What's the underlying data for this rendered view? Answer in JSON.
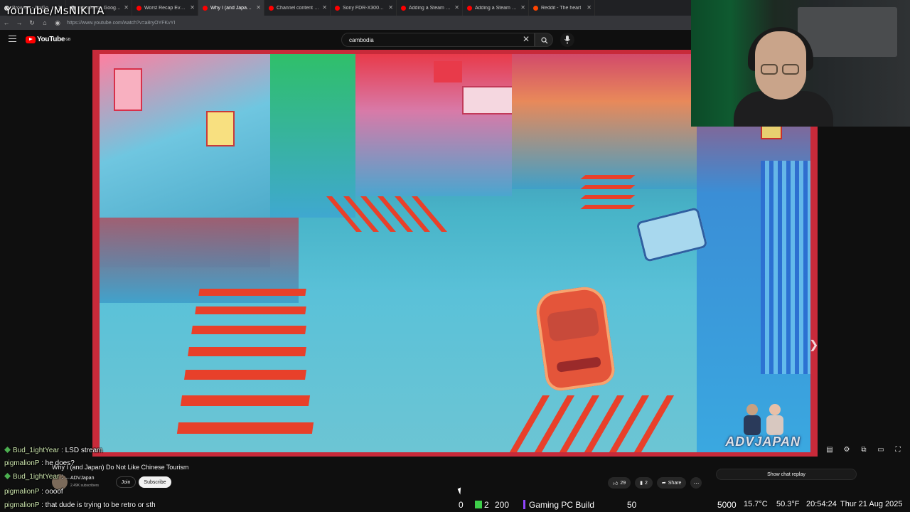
{
  "overlay": {
    "channel_handle": "YouTube/MsNIKITA"
  },
  "browser": {
    "tabs": [
      {
        "title": "Browser - AniGo",
        "favicon_color": "#ffffff",
        "active": false
      },
      {
        "title": "ridiculous - Google S",
        "favicon_color": "#e8eaed",
        "active": false
      },
      {
        "title": "Worst Recap Ever? -",
        "favicon_color": "#ff0000",
        "active": false
      },
      {
        "title": "Why I (and Japan) D",
        "favicon_color": "#ff0000",
        "active": true
      },
      {
        "title": "Channel content - Yo",
        "favicon_color": "#ff0000",
        "active": false
      },
      {
        "title": "Sony FDR-X3000 & A",
        "favicon_color": "#ff0000",
        "active": false
      },
      {
        "title": "Adding a Steam Libr",
        "favicon_color": "#ff0000",
        "active": false
      },
      {
        "title": "Adding a Steam Libr",
        "favicon_color": "#ff0000",
        "active": false
      },
      {
        "title": "Reddit - The heart",
        "favicon_color": "#ff4500",
        "active": false
      }
    ],
    "url": "https://www.youtube.com/watch?v=a8ryOYFKvYI"
  },
  "youtube": {
    "logo_text": "YouTube",
    "logo_superscript": "GB",
    "search_query": "cambodia",
    "video": {
      "title": "Why I (and Japan) Do Not Like Chinese Tourism",
      "channel_name": "ADVJapan",
      "subscribers": "2.49K subscribers",
      "join_label": "Join",
      "subscribe_label": "Subscribe",
      "likes": "29",
      "comments": "2",
      "share_label": "Share",
      "more_label": "⋯",
      "watermark": "ADVJAPAN"
    },
    "show_chat_replay": "Show chat replay"
  },
  "chat": [
    {
      "user": "Bud_1ightYear",
      "message": "LSD stream"
    },
    {
      "user": "pigmalionP",
      "message": "he does?"
    },
    {
      "user": "Bud_1ightYear",
      "message": "..."
    },
    {
      "user": "pigmalionP",
      "message": "oooof"
    },
    {
      "user": "pigmalionP",
      "message": "that dude is trying to be retro or sth"
    }
  ],
  "stream_stats": {
    "stat_a": "0",
    "stat_b": "2",
    "stat_c": "200",
    "category": "Gaming PC Build",
    "stat_d": "50",
    "stat_e": "5000",
    "temperature": "15.7°C",
    "weather_extra": "50.3°F",
    "time": "20:54:24",
    "date": "Thur 21 Aug 2025"
  },
  "colors": {
    "youtube_red": "#ff0000",
    "video_border": "#c82a3a",
    "stat_green": "#3ecf4a",
    "twitch_purple": "#9146ff"
  }
}
